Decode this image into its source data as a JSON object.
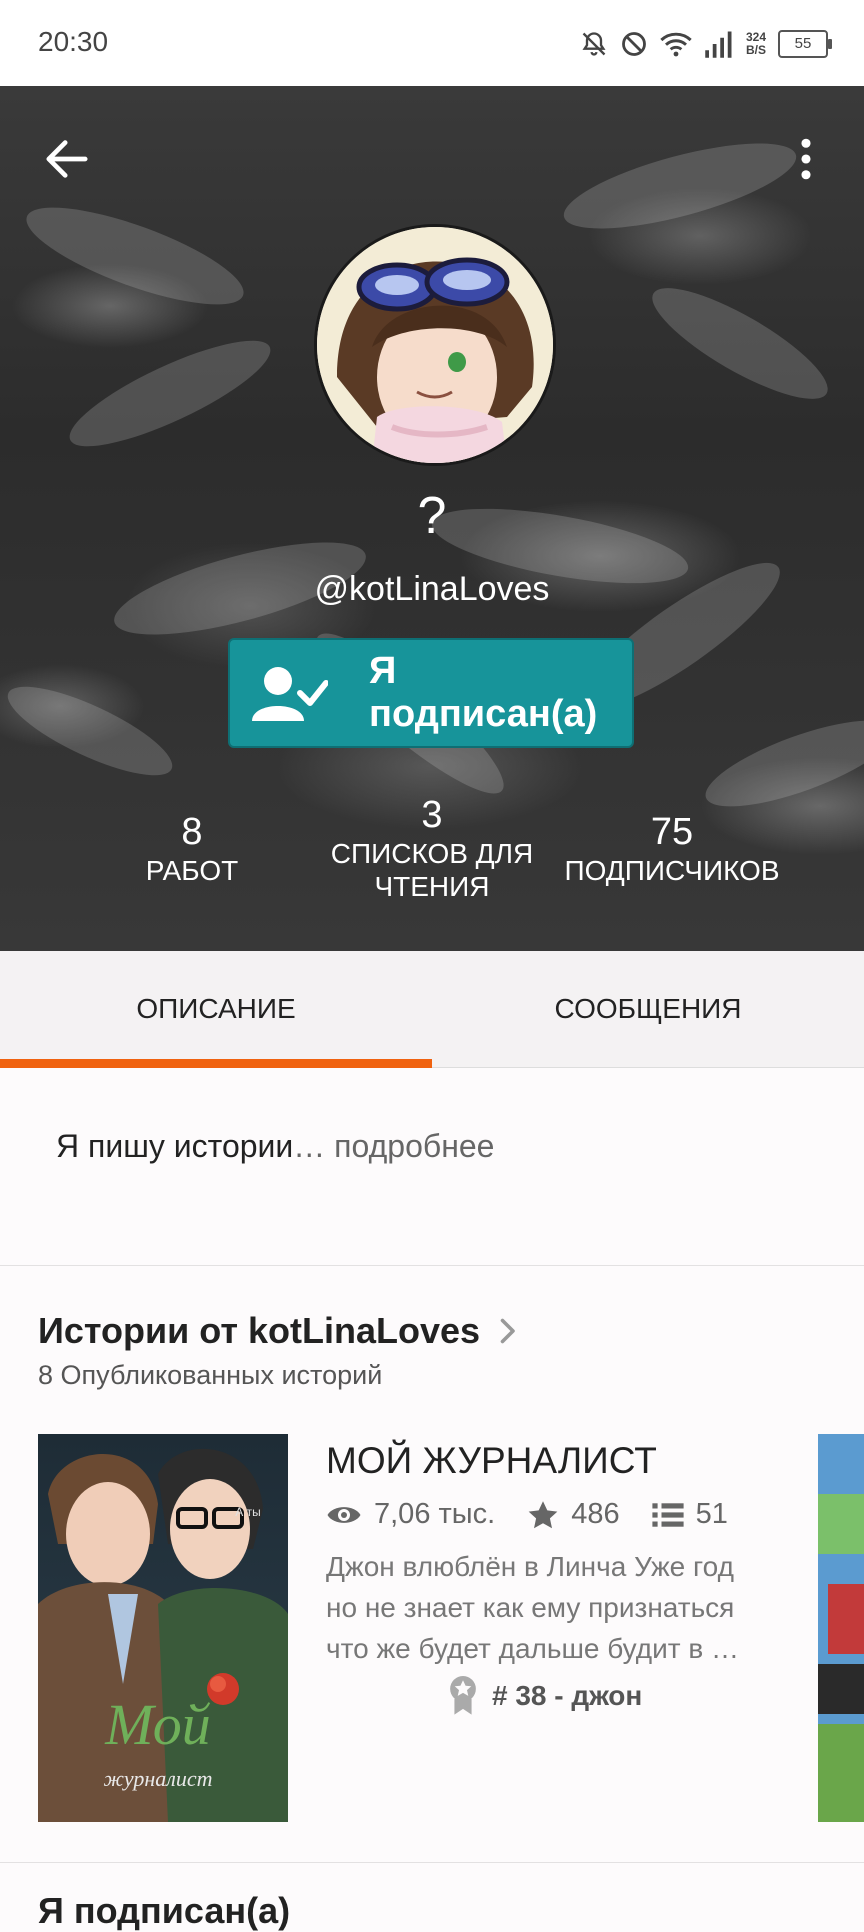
{
  "status_bar": {
    "time": "20:30",
    "net_speed_value": "324",
    "net_speed_unit": "B/S",
    "battery": "55",
    "icons": [
      "bell-off-icon",
      "do-not-disturb-icon",
      "wifi-icon",
      "signal-icon",
      "battery-icon"
    ]
  },
  "profile": {
    "display_name": "?",
    "username": "@kotLinaLoves",
    "follow_button_label": "Я подписан(а)",
    "stats": [
      {
        "value": "8",
        "label": "РАБОТ"
      },
      {
        "value": "3",
        "label": "СПИСКОВ ДЛЯ ЧТЕНИЯ"
      },
      {
        "value": "75",
        "label": "ПОДПИСЧИКОВ"
      }
    ]
  },
  "tabs": [
    {
      "label": "ОПИСАНИЕ",
      "active": true
    },
    {
      "label": "СООБЩЕНИЯ",
      "active": false
    }
  ],
  "accent_color": "#f0620f",
  "follow_color": "#17949a",
  "description": {
    "text": "Я пишу истории",
    "ellipsis": "…",
    "more_link": "подробнее"
  },
  "stories_section": {
    "title": "Истории от kotLinaLoves",
    "subtitle": "8 Опубликованных историй",
    "stories": [
      {
        "title": "МОЙ ЖУРНАЛИСТ",
        "views": "7,06 тыс.",
        "votes": "486",
        "parts": "51",
        "description": "Джон влюблён в Линча Уже год но не знает как ему признаться что же будет дальше будит в …",
        "rank": "# 38 - джон",
        "cover_text": "Мой",
        "cover_subtext": "журналист",
        "cover_corner_text": "А ты"
      }
    ]
  },
  "next_section_title": "Я подписан(а)"
}
